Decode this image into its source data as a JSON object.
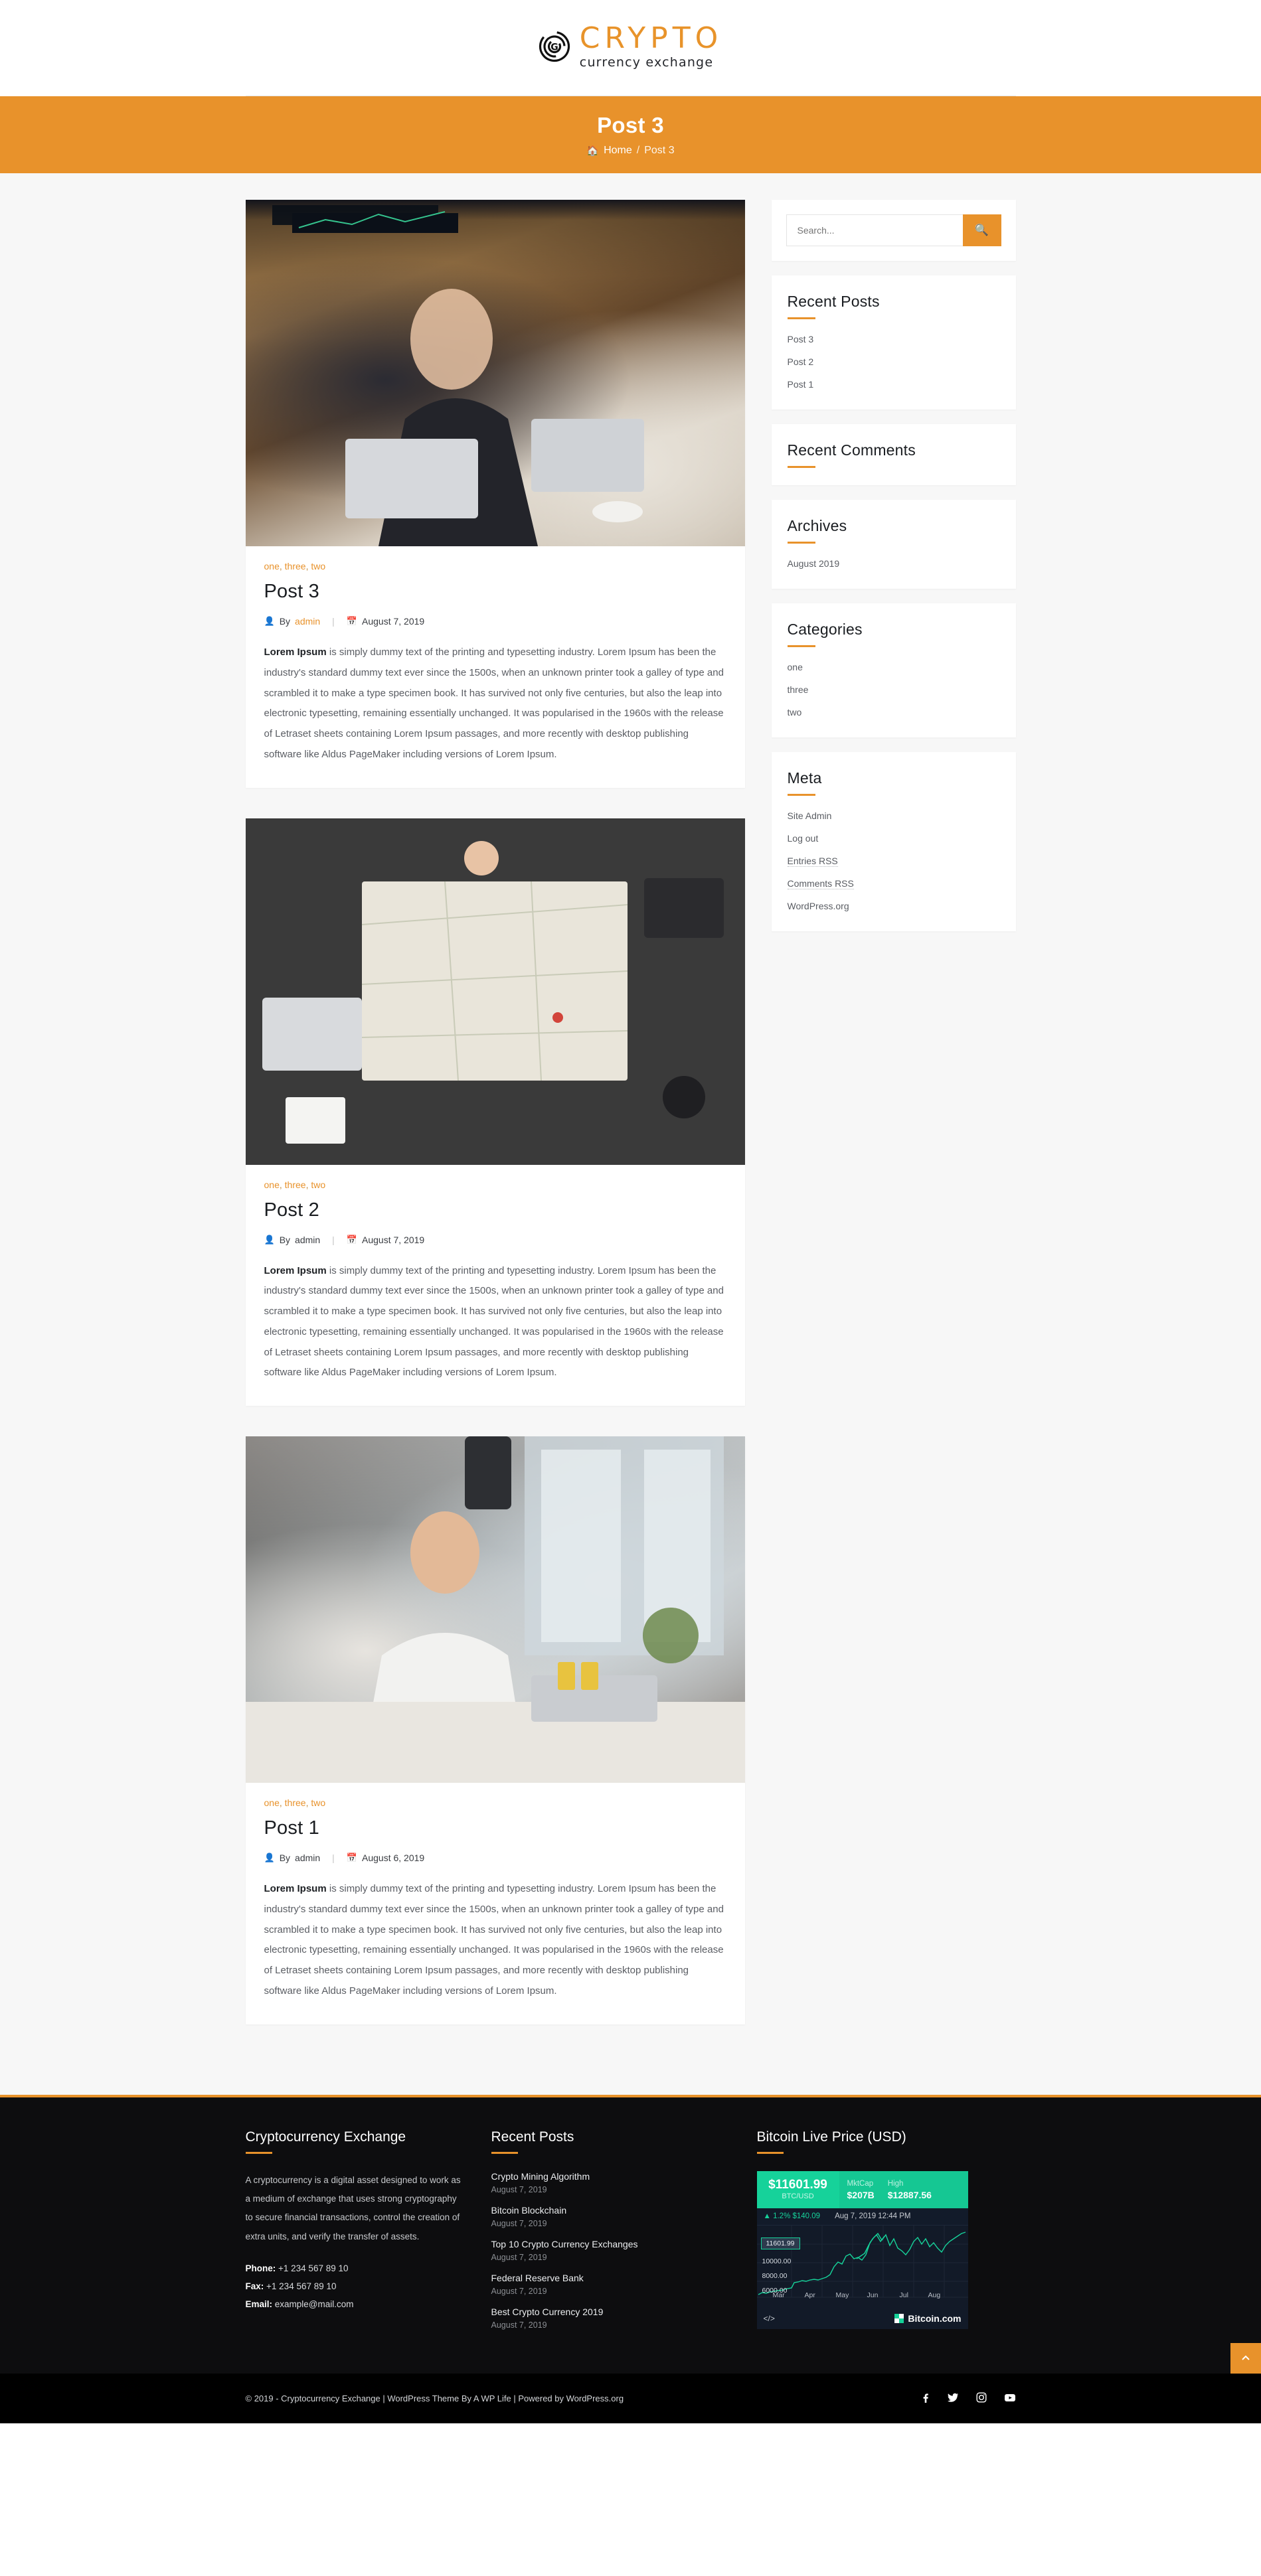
{
  "header": {
    "logo_main": "CRYPTO",
    "logo_sub": "currency exchange"
  },
  "banner": {
    "title": "Post 3",
    "breadcrumb_home": "Home",
    "breadcrumb_sep": "/",
    "breadcrumb_current": "Post 3"
  },
  "posts": [
    {
      "categories": [
        "one",
        "three",
        "two"
      ],
      "title": "Post 3",
      "author_prefix": "By",
      "author": "admin",
      "date": "August 7, 2019",
      "excerpt_lead": "Lorem Ipsum",
      "excerpt": " is simply dummy text of the printing and typesetting industry. Lorem Ipsum has been the industry's standard dummy text ever since the 1500s, when an unknown printer took a galley of type and scrambled it to make a type specimen book. It has survived not only five centuries, but also the leap into electronic typesetting, remaining essentially unchanged. It was popularised in the 1960s with the release of Letraset sheets containing Lorem Ipsum passages, and more recently with desktop publishing software like Aldus PageMaker including versions of Lorem Ipsum."
    },
    {
      "categories": [
        "one",
        "three",
        "two"
      ],
      "title": "Post 2",
      "author_prefix": "By",
      "author": "admin",
      "date": "August 7, 2019",
      "excerpt_lead": "Lorem Ipsum",
      "excerpt": " is simply dummy text of the printing and typesetting industry. Lorem Ipsum has been the industry's standard dummy text ever since the 1500s, when an unknown printer took a galley of type and scrambled it to make a type specimen book. It has survived not only five centuries, but also the leap into electronic typesetting, remaining essentially unchanged. It was popularised in the 1960s with the release of Letraset sheets containing Lorem Ipsum passages, and more recently with desktop publishing software like Aldus PageMaker including versions of Lorem Ipsum."
    },
    {
      "categories": [
        "one",
        "three",
        "two"
      ],
      "title": "Post 1",
      "author_prefix": "By",
      "author": "admin",
      "date": "August 6, 2019",
      "excerpt_lead": "Lorem Ipsum",
      "excerpt": " is simply dummy text of the printing and typesetting industry. Lorem Ipsum has been the industry's standard dummy text ever since the 1500s, when an unknown printer took a galley of type and scrambled it to make a type specimen book. It has survived not only five centuries, but also the leap into electronic typesetting, remaining essentially unchanged. It was popularised in the 1960s with the release of Letraset sheets containing Lorem Ipsum passages, and more recently with desktop publishing software like Aldus PageMaker including versions of Lorem Ipsum."
    }
  ],
  "sidebar": {
    "search": {
      "placeholder": "Search...",
      "value": "",
      "button_icon": "search-icon"
    },
    "recent_posts": {
      "title": "Recent Posts",
      "items": [
        "Post 3",
        "Post 2",
        "Post 1"
      ]
    },
    "recent_comments": {
      "title": "Recent Comments",
      "items": []
    },
    "archives": {
      "title": "Archives",
      "items": [
        "August 2019"
      ]
    },
    "categories": {
      "title": "Categories",
      "items": [
        "one",
        "three",
        "two"
      ]
    },
    "meta": {
      "title": "Meta",
      "items": [
        "Site Admin",
        "Log out",
        "Entries RSS",
        "Comments RSS",
        "WordPress.org"
      ]
    }
  },
  "footer": {
    "about": {
      "title": "Cryptocurrency Exchange",
      "text": "A cryptocurrency is a digital asset designed to work as a medium of exchange that uses strong cryptography to secure financial transactions, control the creation of extra units, and verify the transfer of assets.",
      "phone_label": "Phone:",
      "phone": "+1 234 567 89 10",
      "fax_label": "Fax:",
      "fax": "+1 234 567 89 10",
      "email_label": "Email:",
      "email": "example@mail.com"
    },
    "recent_posts": {
      "title": "Recent Posts",
      "items": [
        {
          "title": "Crypto Mining Algorithm",
          "date": "August 7, 2019"
        },
        {
          "title": "Bitcoin Blockchain",
          "date": "August 7, 2019"
        },
        {
          "title": "Top 10 Crypto Currency Exchanges",
          "date": "August 7, 2019"
        },
        {
          "title": "Federal Reserve Bank",
          "date": "August 7, 2019"
        },
        {
          "title": "Best Crypto Currency 2019",
          "date": "August 7, 2019"
        }
      ]
    },
    "bitcoin": {
      "title": "Bitcoin Live Price (USD)",
      "price": "$11601.99",
      "pair": "BTC/USD",
      "mktcap_label": "MktCap",
      "mktcap_value": "$207B",
      "high_label": "High",
      "high_value": "$12887.56",
      "change": "▲ 1.2%  $140.09",
      "timestamp": "Aug 7, 2019 12:44 PM",
      "price_tag": "11601.99",
      "embed_icon": "</>",
      "brand": "Bitcoin.com"
    },
    "copyright": "© 2019 - Cryptocurrency Exchange | WordPress Theme By A WP Life | Powered by WordPress.org",
    "social": [
      "facebook",
      "twitter",
      "instagram",
      "youtube"
    ],
    "scroll_top_icon": "chevron-up-icon"
  },
  "chart_data": {
    "type": "line",
    "title": "Bitcoin Live Price (USD)",
    "xlabel": "",
    "ylabel": "",
    "x": [
      "Mar",
      "Apr",
      "May",
      "Jun",
      "Jul",
      "Aug"
    ],
    "ylim": [
      3500,
      13000
    ],
    "yticks": [
      6000,
      8000,
      10000
    ],
    "ytick_labels": [
      "6000.00",
      "8000.00",
      "10000.00"
    ],
    "grid": true,
    "legend": "none",
    "series": [
      {
        "name": "BTC/USD",
        "color": "#16d29a",
        "values": [
          3900,
          4000,
          4050,
          4100,
          4200,
          4300,
          5200,
          5300,
          5400,
          5450,
          5500,
          5700,
          5800,
          5750,
          6000,
          5900,
          6100,
          7300,
          8100,
          7900,
          8600,
          8700,
          8300,
          8400,
          8200,
          9000,
          10800,
          11900,
          12600,
          11400,
          12400,
          11000,
          11800,
          10400,
          10200,
          9800,
          10600,
          11500,
          11601.99
        ]
      }
    ],
    "annotations": [
      {
        "text": "11601.99",
        "type": "current-price-tag"
      },
      {
        "text": "Aug 7, 2019 12:44 PM",
        "type": "timestamp"
      }
    ]
  }
}
